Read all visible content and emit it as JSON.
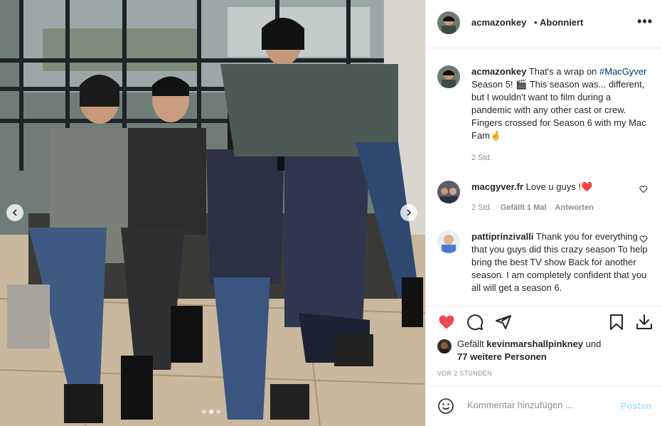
{
  "header": {
    "username": "acmazonkey",
    "separator": "•",
    "follow_status": "Abonniert",
    "more": "•••"
  },
  "caption": {
    "username": "acmazonkey",
    "text_before": " That's a wrap on ",
    "hashtag": "#MacGyver",
    "text_after": " Season 5! 🎬 This season was... different, but I wouldn't want to film during a pandemic with any other cast or crew. Fingers crossed for Season 6 with my Mac Fam🤞",
    "time": "2 Std."
  },
  "comments": [
    {
      "username": "macgyver.fr",
      "text": " Love u guys !❤️",
      "time": "2 Std.",
      "likes": "Gefällt 1 Mal",
      "reply": "Antworten"
    },
    {
      "username": "pattiprinzivalli",
      "text": " Thank you for everything that you guys did this crazy season To help bring the best TV show Back for another season. I am completely confident that you all will get a season 6."
    }
  ],
  "likes": {
    "prefix": "Gefällt ",
    "user": "kevinmarshallpinkney",
    "suffix": " und",
    "others": "77 weitere Personen"
  },
  "timestamp": "VOR 2 STUNDEN",
  "comment_box": {
    "placeholder": "Kommentar hinzufügen ...",
    "post_label": "Posten"
  },
  "colors": {
    "like_red": "#ed4956",
    "link_blue": "#00376b",
    "post_disabled": "#b2dffc"
  },
  "carousel": {
    "current_index": 2,
    "total": 3
  }
}
